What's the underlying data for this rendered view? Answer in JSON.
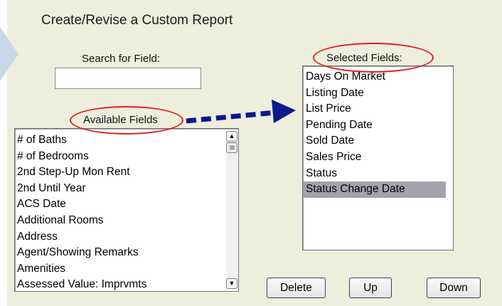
{
  "title": "Create/Revise a Custom Report",
  "search": {
    "label": "Search for Field:",
    "value": ""
  },
  "available": {
    "label": "Available Fields",
    "items": [
      "# of Baths",
      "# of Bedrooms",
      "2nd Step-Up Mon Rent",
      "2nd Until Year",
      "ACS Date",
      "Additional Rooms",
      "Address",
      "Agent/Showing Remarks",
      "Amenities",
      "Assessed Value: Imprvmts"
    ]
  },
  "selected": {
    "label": "Selected Fields:",
    "items": [
      "Days On Market",
      "Listing Date",
      "List Price",
      "Pending Date",
      "Sold Date",
      "Sales Price",
      "Status",
      "Status Change Date"
    ],
    "selected_item": "Status Change Date"
  },
  "buttons": {
    "delete": "Delete",
    "up": "Up",
    "down": "Down"
  },
  "icons": {
    "scroll_up": "scroll-up-arrow-icon",
    "scroll_down": "scroll-down-arrow-icon",
    "annotation_arrow": "dashed-arrow-icon"
  },
  "colors": {
    "panel_bg": "#eeeedd",
    "highlight": "#a3a3ae",
    "annotation_red": "#e22020",
    "annotation_arrow": "#0a1a8c",
    "button_border": "#2e3e6b"
  }
}
